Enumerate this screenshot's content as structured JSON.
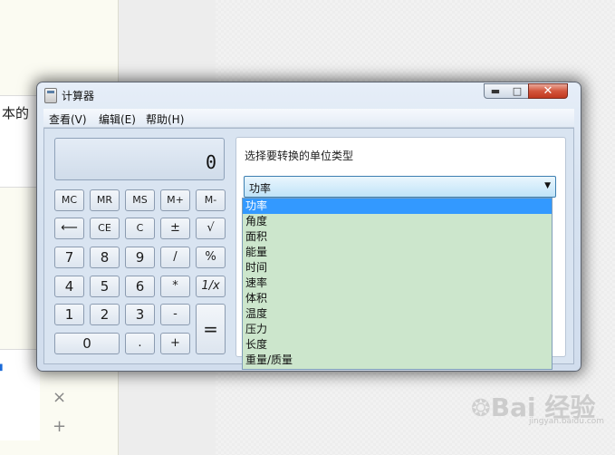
{
  "background": {
    "left_text": "本的",
    "tool_icons": [
      "×",
      "+"
    ]
  },
  "window": {
    "title": "计算器",
    "controls": {
      "minimize": "▬",
      "maximize": "□",
      "close": "✕"
    }
  },
  "menu": [
    "查看(V)",
    "编辑(E)",
    "帮助(H)"
  ],
  "display": {
    "value": "0"
  },
  "keys": {
    "mc": "MC",
    "mr": "MR",
    "ms": "MS",
    "mplus": "M+",
    "mminus": "M-",
    "backspace": "⟵",
    "ce": "CE",
    "c": "C",
    "plusminus": "±",
    "sqrt": "√",
    "seven": "7",
    "eight": "8",
    "nine": "9",
    "divide": "/",
    "percent": "%",
    "four": "4",
    "five": "5",
    "six": "6",
    "multiply": "*",
    "reciprocal": "1/x",
    "one": "1",
    "two": "2",
    "three": "3",
    "minus": "-",
    "equals": "=",
    "zero": "0",
    "decimal": ".",
    "plus": "+"
  },
  "conversion": {
    "label": "选择要转换的单位类型",
    "selected": "功率",
    "options": [
      "功率",
      "角度",
      "面积",
      "能量",
      "时间",
      "速率",
      "体积",
      "温度",
      "压力",
      "长度",
      "重量/质量"
    ]
  },
  "watermark": {
    "text": "Bai 经验",
    "sub": "jingyan.baidu.com"
  },
  "colors": {
    "selection": "#3399ff",
    "dropdown_bg": "#cce6cc",
    "close_button": "#c0391f"
  }
}
